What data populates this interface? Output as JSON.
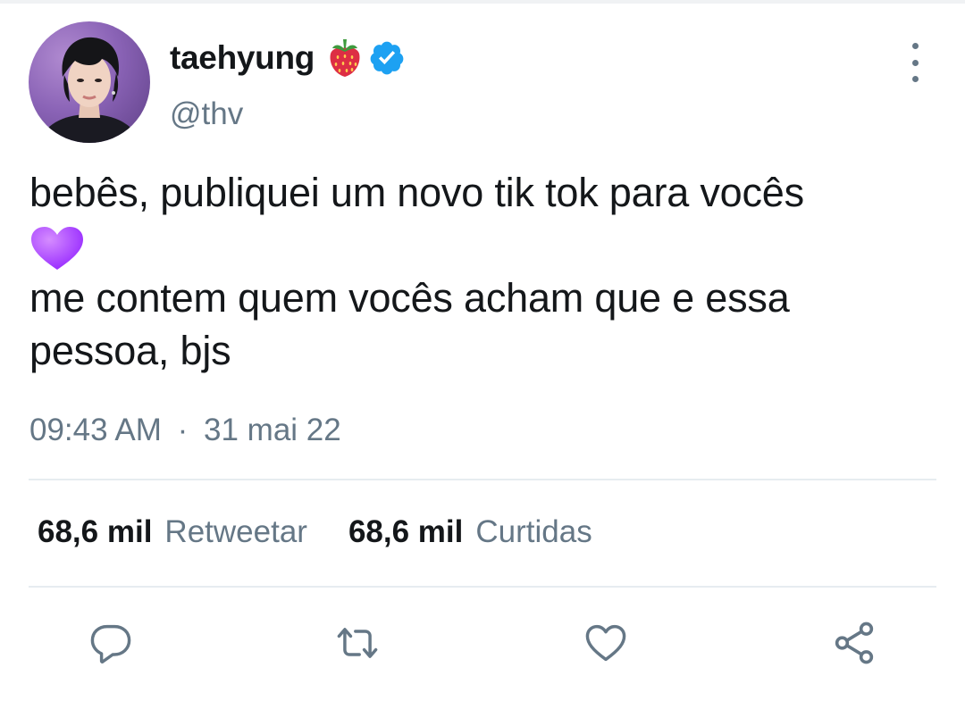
{
  "user": {
    "display_name": "taehyung",
    "handle": "@thv",
    "name_emoji": "strawberry-icon",
    "verified": true
  },
  "tweet": {
    "line1": "bebês, publiquei um novo tik tok para vocês",
    "line2_emoji": "purple-heart",
    "line3": "me contem quem vocês acham que e essa",
    "line4": "pessoa, bjs",
    "time": "09:43 AM",
    "separator": "·",
    "date": "31 mai 22"
  },
  "stats": {
    "retweets_count": "68,6 mil",
    "retweets_label": "Retweetar",
    "likes_count": "68,6 mil",
    "likes_label": "Curtidas"
  },
  "actions": [
    "reply-icon",
    "retweet-icon",
    "like-icon",
    "share-icon"
  ],
  "colors": {
    "text_primary": "#14171a",
    "text_secondary": "#657786",
    "verified_blue": "#1da1f2",
    "divider": "#e6ecf0",
    "heart_purple": "#a64dff"
  }
}
